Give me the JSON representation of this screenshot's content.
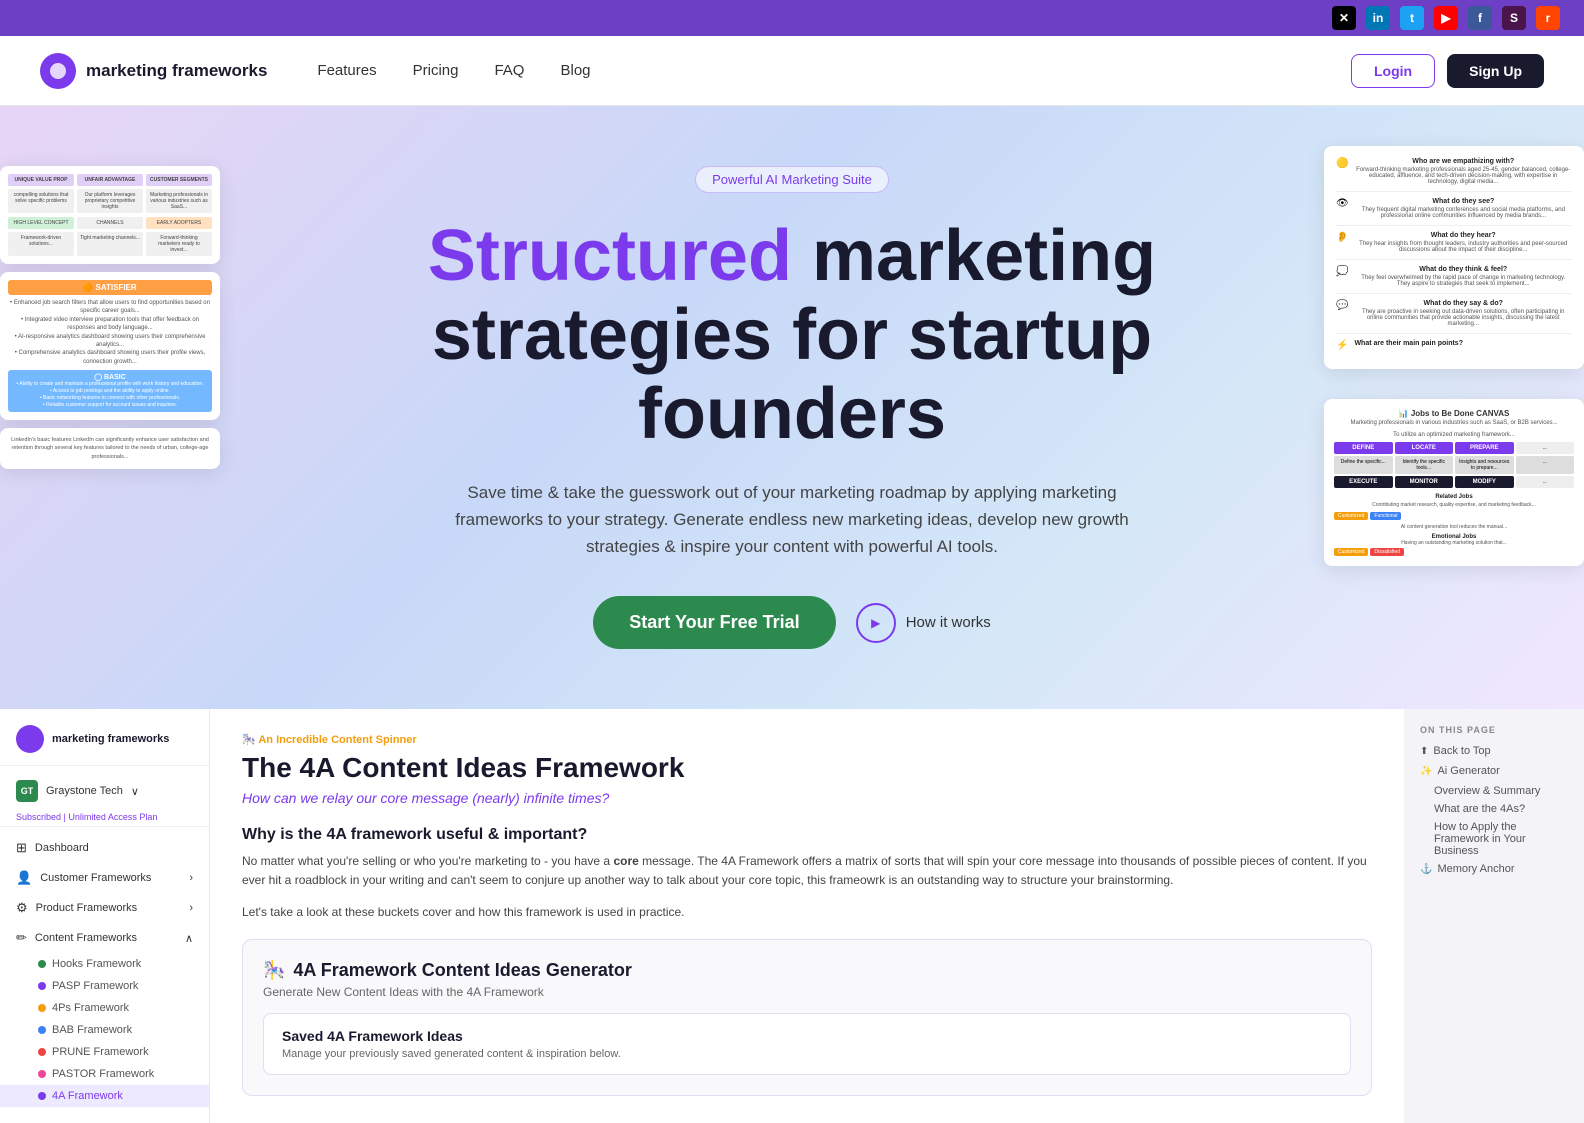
{
  "social_bar": {
    "icons": [
      {
        "name": "twitter-x-icon",
        "label": "X",
        "class": "twitter"
      },
      {
        "name": "linkedin-icon",
        "label": "in",
        "class": "linkedin"
      },
      {
        "name": "twitter-icon",
        "label": "t",
        "class": "twitter-blue"
      },
      {
        "name": "youtube-icon",
        "label": "▶",
        "class": "youtube"
      },
      {
        "name": "facebook-icon",
        "label": "f",
        "class": "facebook"
      },
      {
        "name": "slack-icon",
        "label": "S",
        "class": "slack"
      },
      {
        "name": "reddit-icon",
        "label": "r",
        "class": "reddit"
      }
    ]
  },
  "nav": {
    "logo_text": "marketing frameworks",
    "links": [
      "Features",
      "Pricing",
      "FAQ",
      "Blog"
    ],
    "login": "Login",
    "signup": "Sign Up"
  },
  "hero": {
    "badge": "Powerful AI Marketing Suite",
    "title_part1": "Structured",
    "title_part2": " marketing strategies for startup founders",
    "subtitle": "Save time & take the guesswork out of your marketing roadmap by applying marketing frameworks to your strategy.  Generate endless new marketing ideas, develop new growth strategies & inspire your content with powerful AI tools.",
    "cta": "Start Your Free Trial",
    "how_it_works": "How it works"
  },
  "app": {
    "logo": "marketing frameworks",
    "org": "Graystone Tech",
    "subscription": "Subscribed | Unlimited Access Plan",
    "nav_items": [
      {
        "label": "Dashboard",
        "icon": "⊞"
      },
      {
        "label": "Customer Frameworks",
        "icon": "👤",
        "arrow": true
      },
      {
        "label": "Product Frameworks",
        "icon": "⚙",
        "arrow": true
      },
      {
        "label": "Content Frameworks",
        "icon": "✏",
        "arrow": true
      }
    ],
    "sub_items": [
      {
        "label": "Hooks Framework",
        "dot": "green"
      },
      {
        "label": "PASP Framework",
        "dot": "purple"
      },
      {
        "label": "4Ps Framework",
        "dot": "orange"
      },
      {
        "label": "BAB Framework",
        "dot": "blue"
      },
      {
        "label": "PRUNE Framework",
        "dot": "red"
      },
      {
        "label": "PASTOR Framework",
        "dot": "pink"
      },
      {
        "label": "4A Framework",
        "dot": "active-dot",
        "active": true
      }
    ]
  },
  "content": {
    "tag": "🎠 An Incredible Content Spinner",
    "title": "The 4A Content Ideas Framework",
    "subtitle": "How can we relay our core message (nearly) infinite times?",
    "section1_title": "Why is the 4A framework useful & important?",
    "section1_body": "No matter what you're selling or who you're marketing to - you have a core message. The 4A Framework offers a matrix of sorts that will spin your core message into thousands of possible pieces of content. If you ever hit a roadblock in your writing and can't seem to conjure up another way to talk about your core topic, this frameowrk is an outstanding way to structure your brainstorming.",
    "section1_note": "Let's take a look at these buckets cover and how this framework is used in practice.",
    "generator_title": "4A Framework Content Ideas Generator",
    "generator_emoji": "🎠",
    "generator_sub": "Generate New Content Ideas with the 4A Framework",
    "saved_title": "Saved 4A Framework Ideas",
    "saved_sub": "Manage your previously saved generated content & inspiration below."
  },
  "toc": {
    "header": "ON THIS PAGE",
    "items": [
      {
        "label": "Back to Top",
        "icon": "⬆"
      },
      {
        "label": "Ai Generator",
        "icon": "✨"
      },
      {
        "label": "Overview & Summary"
      },
      {
        "label": "What are the 4As?"
      },
      {
        "label": "How to Apply the Framework in Your Business"
      },
      {
        "label": "Memory Anchor",
        "icon": "⚓"
      }
    ]
  }
}
